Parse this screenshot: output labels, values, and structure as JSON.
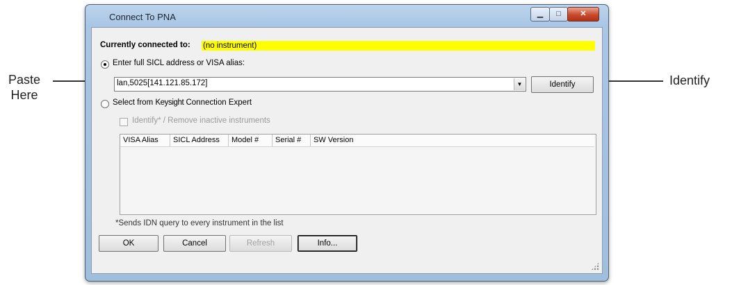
{
  "callouts": {
    "left_line1": "Paste",
    "left_line2": "Here",
    "right": "Identify"
  },
  "window": {
    "title": "Connect To PNA",
    "minimize_glyph": "▁",
    "maximize_glyph": "□",
    "close_glyph": "✕"
  },
  "status": {
    "label": "Currently connected to:",
    "value": "(no instrument)",
    "highlight_color": "#ffff00"
  },
  "address_option": {
    "label": "Enter full SICL address or VISA alias:",
    "selected": true
  },
  "address_input": {
    "value": "lan,5025[141.121.85.172]",
    "dropdown_arrow": "▼"
  },
  "identify_button": {
    "label": "Identify"
  },
  "expert_option": {
    "label_prefix": "Select from ",
    "label_brand": "Keysight",
    "label_suffix": " Connection Expert",
    "selected": false
  },
  "remove_inactive": {
    "label": "Identify* / Remove inactive instruments",
    "checked": false,
    "enabled": false
  },
  "instrument_table": {
    "columns": [
      "VISA Alias",
      "SICL Address",
      "Model #",
      "Serial #",
      "SW Version"
    ],
    "rows": []
  },
  "footnote": "*Sends IDN query to every instrument in the list",
  "buttons": {
    "ok": "OK",
    "cancel": "Cancel",
    "refresh": "Refresh",
    "info": "Info..."
  }
}
